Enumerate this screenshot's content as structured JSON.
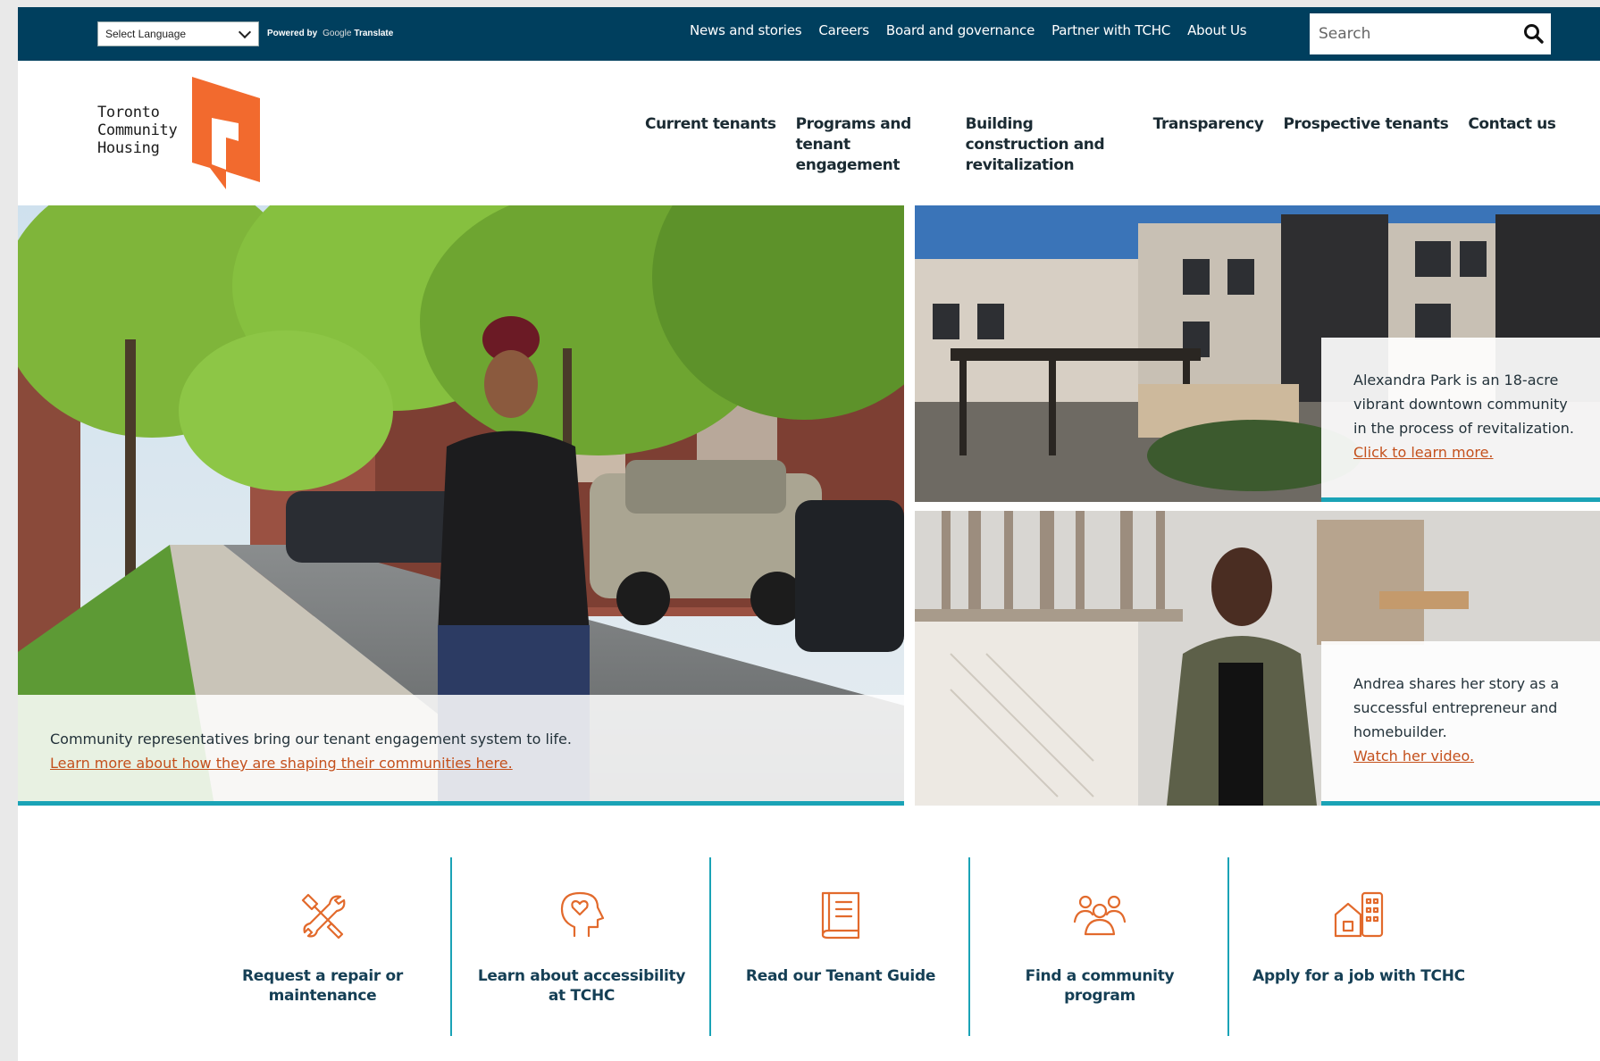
{
  "colors": {
    "topbar": "#003f5e",
    "accent_orange": "#f26a2e",
    "link_orange": "#c4501c",
    "teal": "#1aa3b6",
    "heading_navy": "#153f55"
  },
  "topbar": {
    "language_select": "Select Language",
    "powered_by": "Powered by",
    "google": "Google",
    "translate": "Translate",
    "nav": [
      {
        "label": "News and stories"
      },
      {
        "label": "Careers"
      },
      {
        "label": "Board and governance"
      },
      {
        "label": "Partner with TCHC"
      },
      {
        "label": "About Us"
      }
    ],
    "search_placeholder": "Search",
    "search_icon": "search-icon"
  },
  "logo": {
    "line1": "Toronto",
    "line2": "Community",
    "line3": "Housing"
  },
  "main_nav": [
    {
      "label": "Current tenants"
    },
    {
      "label": "Programs and tenant engagement"
    },
    {
      "label": "Building construction and revitalization"
    },
    {
      "label": "Transparency"
    },
    {
      "label": "Prospective tenants"
    },
    {
      "label": "Contact us"
    }
  ],
  "hero": {
    "text": "Community representatives bring our tenant engagement system to life.",
    "link": "Learn more about how they are shaping their communities here."
  },
  "cards": [
    {
      "text": "Alexandra Park is an 18-acre vibrant downtown community in the process of revitalization.",
      "link": "Click to learn more."
    },
    {
      "text": "Andrea shares her story as a successful entrepreneur and homebuilder.",
      "link": "Watch her video."
    }
  ],
  "quick_links": [
    {
      "label": "Request a repair or maintenance",
      "icon": "tools-icon"
    },
    {
      "label": "Learn about accessibility at TCHC",
      "icon": "head-heart-icon"
    },
    {
      "label": "Read our Tenant Guide",
      "icon": "book-icon"
    },
    {
      "label": "Find a community program",
      "icon": "people-icon"
    },
    {
      "label": "Apply for a job with TCHC",
      "icon": "buildings-icon"
    }
  ]
}
